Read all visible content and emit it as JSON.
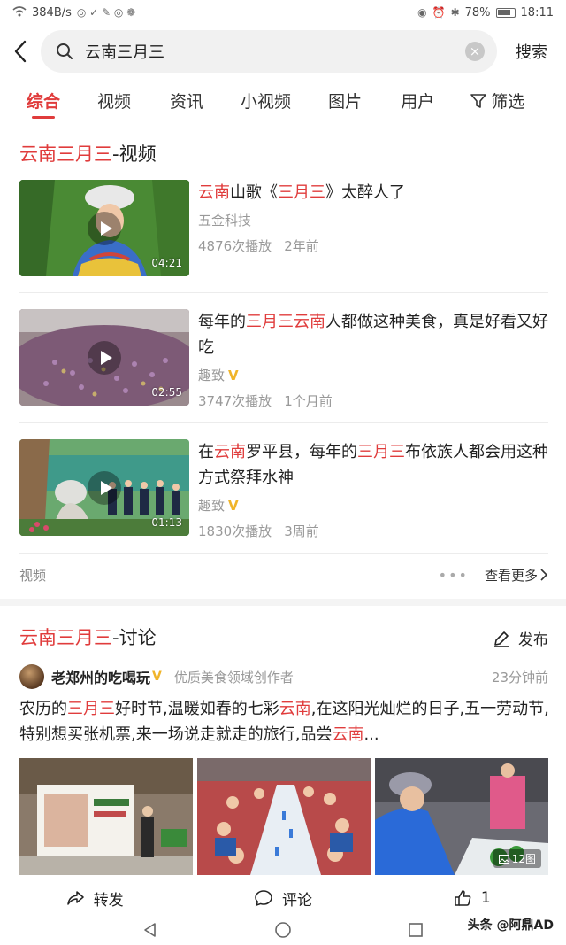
{
  "status_bar": {
    "net_speed": "384B/s",
    "battery": "78%",
    "time": "18:11"
  },
  "header": {
    "query": "云南三月三",
    "search_label": "搜索"
  },
  "tabs": [
    {
      "label": "综合",
      "active": true
    },
    {
      "label": "视频"
    },
    {
      "label": "资讯"
    },
    {
      "label": "小视频"
    },
    {
      "label": "图片"
    },
    {
      "label": "用户"
    }
  ],
  "filter_label": "筛选",
  "video_section": {
    "title_highlight": "云南三月三",
    "title_suffix": "-视频",
    "footer_label": "视频",
    "more_label": "查看更多",
    "videos": [
      {
        "title_parts": [
          {
            "t": "云南",
            "hl": true
          },
          {
            "t": "山歌《",
            "hl": false
          },
          {
            "t": "三月三",
            "hl": true
          },
          {
            "t": "》太醉人了",
            "hl": false
          }
        ],
        "source": "五金科技",
        "verified": false,
        "plays": "4876次播放",
        "age": "2年前",
        "duration": "04:21"
      },
      {
        "title_parts": [
          {
            "t": "每年的",
            "hl": false
          },
          {
            "t": "三月三",
            "hl": true
          },
          {
            "t": "云南",
            "hl": true
          },
          {
            "t": "人都做这种美食，真是好看又好吃",
            "hl": false
          }
        ],
        "source": "趣致",
        "verified": true,
        "plays": "3747次播放",
        "age": "1个月前",
        "duration": "02:55"
      },
      {
        "title_parts": [
          {
            "t": "在",
            "hl": false
          },
          {
            "t": "云南",
            "hl": true
          },
          {
            "t": "罗平县，每年的",
            "hl": false
          },
          {
            "t": "三月三",
            "hl": true
          },
          {
            "t": "布依族人都会用这种方式祭拜水神",
            "hl": false
          }
        ],
        "source": "趣致",
        "verified": true,
        "plays": "1830次播放",
        "age": "3周前",
        "duration": "01:13"
      }
    ]
  },
  "discussion_section": {
    "title_highlight": "云南三月三",
    "title_suffix": "-讨论",
    "post_label": "发布",
    "post": {
      "author": "老郑州的吃喝玩",
      "author_desc": "优质美食领域创作者",
      "time": "23分钟前",
      "text_parts": [
        {
          "t": "农历的",
          "hl": false
        },
        {
          "t": "三月三",
          "hl": true
        },
        {
          "t": "好时节,温暖如春的七彩",
          "hl": false
        },
        {
          "t": "云南",
          "hl": true
        },
        {
          "t": ",在这阳光灿烂的日子,五一劳动节,特别想买张机票,来一场说走就走的旅行,品尝",
          "hl": false
        },
        {
          "t": "云南",
          "hl": true
        },
        {
          "t": "...",
          "hl": false
        }
      ],
      "photo_count": "12图",
      "actions": {
        "share": "转发",
        "comment": "评论",
        "like": "1"
      }
    }
  },
  "watermark": "头条 @阿鼎AD",
  "colors": {
    "accent": "#e03c3c",
    "badge": "#f0b429"
  }
}
